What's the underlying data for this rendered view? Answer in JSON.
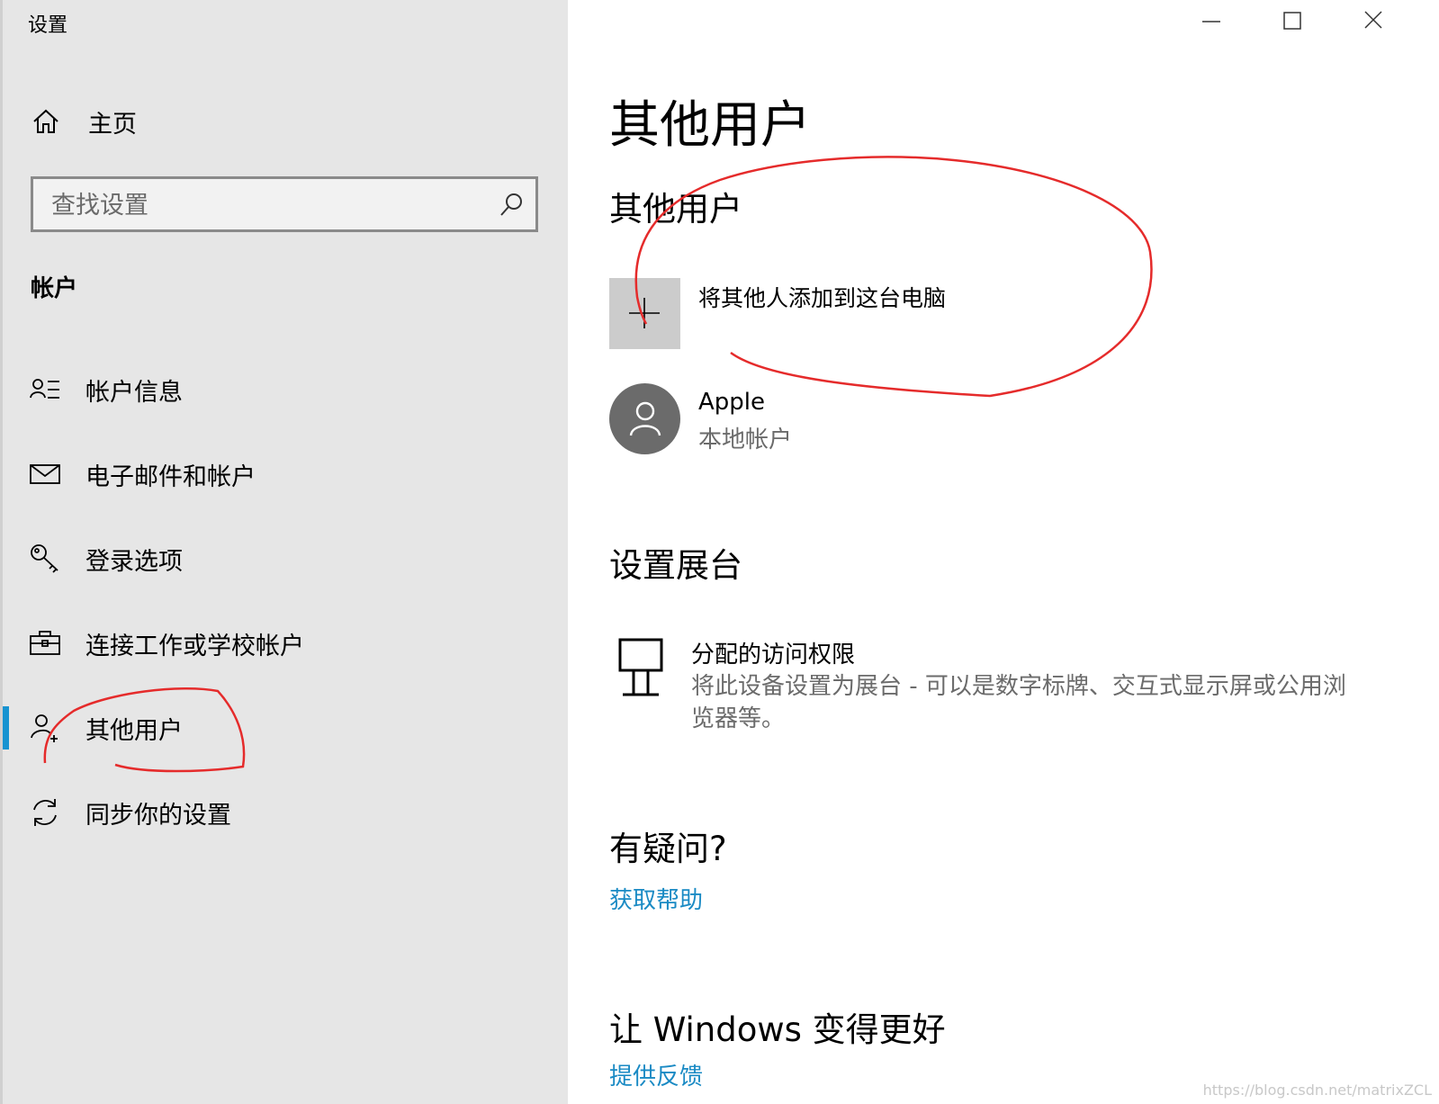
{
  "window": {
    "app_title": "设置",
    "controls": {
      "minimize_icon": "minimize-icon",
      "maximize_icon": "maximize-icon",
      "close_icon": "close-icon"
    }
  },
  "sidebar": {
    "home_label": "主页",
    "search_placeholder": "查找设置",
    "section_heading": "帐户",
    "items": [
      {
        "label": "帐户信息",
        "icon": "account-info-icon"
      },
      {
        "label": "电子邮件和帐户",
        "icon": "mail-icon"
      },
      {
        "label": "登录选项",
        "icon": "key-icon"
      },
      {
        "label": "连接工作或学校帐户",
        "icon": "briefcase-icon"
      },
      {
        "label": "其他用户",
        "icon": "add-person-icon",
        "selected": true
      },
      {
        "label": "同步你的设置",
        "icon": "sync-icon"
      }
    ]
  },
  "main": {
    "page_title": "其他用户",
    "other_users": {
      "heading": "其他用户",
      "add_label": "将其他人添加到这台电脑",
      "users": [
        {
          "name": "Apple",
          "type": "本地帐户"
        }
      ]
    },
    "kiosk": {
      "heading": "设置展台",
      "title": "分配的访问权限",
      "description": "将此设备设置为展台 - 可以是数字标牌、交互式显示屏或公用浏览器等。"
    },
    "questions": {
      "heading": "有疑问?",
      "link": "获取帮助"
    },
    "feedback": {
      "heading": "让 Windows 变得更好",
      "link": "提供反馈"
    }
  },
  "watermark": "https://blog.csdn.net/matrixZCL",
  "colors": {
    "accent": "#1793d1",
    "link": "#1a8ac4",
    "annotation": "#e52b2b",
    "sidebar_bg": "#e6e6e6"
  }
}
